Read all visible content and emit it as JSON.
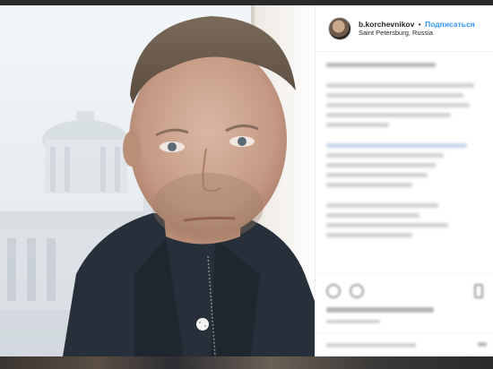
{
  "post": {
    "username": "b.korchevnikov",
    "separator": "•",
    "follow_label": "Подписаться",
    "location": "Saint Petersburg, Russia"
  },
  "photo": {
    "subject": "selfie-photo"
  },
  "colors": {
    "follow_blue": "#3897f0",
    "text_dark": "#262626",
    "border": "#efefef"
  }
}
